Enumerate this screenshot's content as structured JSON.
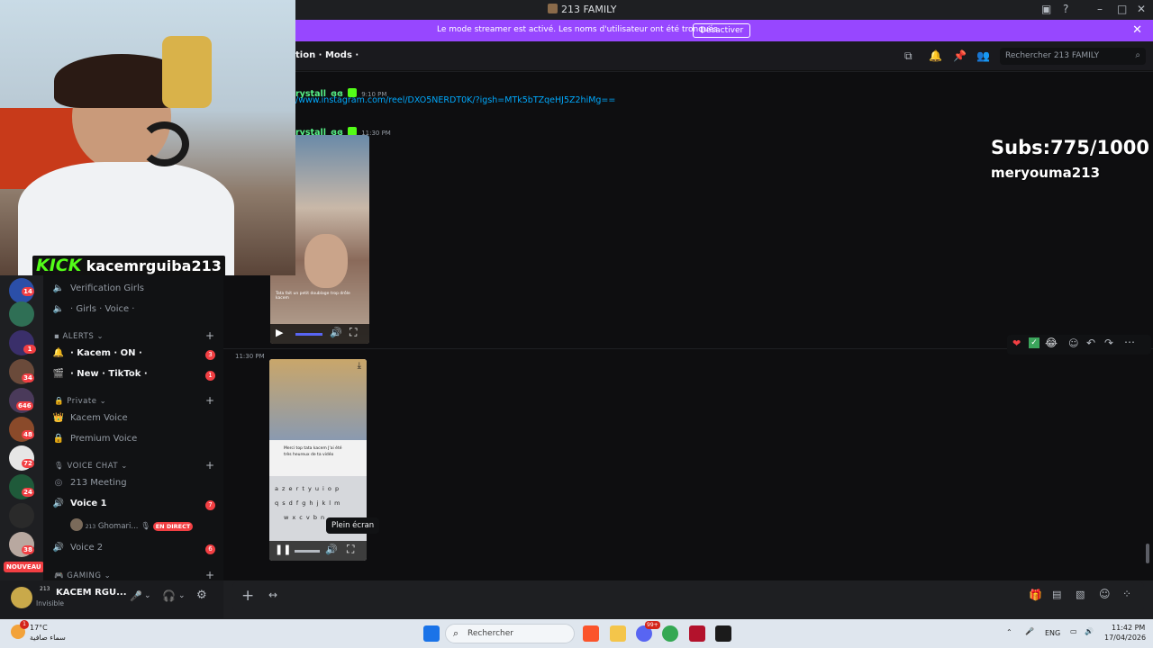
{
  "window": {
    "title": "213 FAMILY"
  },
  "banner": {
    "text": "Le mode streamer est activé. Les noms d'utilisateur ont été tronqués.",
    "button_label": "Désactiver"
  },
  "header": {
    "breadcrumb": "tion · Mods ·",
    "search_placeholder": "Rechercher 213 FAMILY"
  },
  "server_rail": {
    "badges": [
      "14",
      "1",
      "34",
      "646",
      "48",
      "72",
      "24",
      "38"
    ],
    "new_label": "NOUVEAU"
  },
  "channels": {
    "items": [
      {
        "label": "Verification Girls"
      },
      {
        "label": "· Girls · Voice ·"
      },
      {
        "label": "ALERTS"
      },
      {
        "label": "· Kacem · ON ·",
        "badge": "3"
      },
      {
        "label": "· New · TikTok ·",
        "badge": "1"
      },
      {
        "label": "Private"
      },
      {
        "label": "Kacem Voice"
      },
      {
        "label": "Premium Voice"
      },
      {
        "label": "VOICE CHAT"
      },
      {
        "label": "213 Meeting"
      },
      {
        "label": "Voice 1",
        "badge": "7"
      },
      {
        "label": "Voice 2",
        "badge": "6"
      },
      {
        "label": "GAMING"
      }
    ],
    "voice_user": {
      "name": "Ghomari...",
      "live_label": "EN DIRECT",
      "tag": "213"
    }
  },
  "user_panel": {
    "name": "KACEM RGU...",
    "tag": "213",
    "status": "Invisible"
  },
  "messages": [
    {
      "author": "rystall",
      "author_suffix": "ɞɞ",
      "time": "9:10 PM",
      "link": "/www.instagram.com/reel/DXO5NERDT0K/?igsh=MTk5bTZqeHJ5Z2hiMg=="
    },
    {
      "author": "rystall",
      "author_suffix": "ɞɞ",
      "time": "11:30 PM",
      "video_caption": "Tata fait un petit doublage trop drôle kacem"
    },
    {
      "time": "11:30 PM",
      "video_text": "Merci top tata kacem J'ai été très heureux de ta vidéo",
      "keyboard_rows": [
        "a z e r t y u i o p",
        "q s d f g h j k l m",
        "w x c v b n"
      ]
    }
  ],
  "reactions": [
    "heart",
    "check",
    "joy"
  ],
  "tooltip": "Plein écran",
  "overlay": {
    "subs": "Subs:775/1000",
    "sub_user": "meryouma213",
    "kick_label": "KICK",
    "kick_channel": "kacemrguiba213"
  },
  "taskbar": {
    "weather_temp": "17°C",
    "weather_desc": "سماء صافية",
    "weather_badge": "1",
    "search_label": "Rechercher",
    "discord_badge": "99+",
    "lang": "ENG",
    "time": "11:42 PM",
    "date": "17/04/2026"
  },
  "colors": {
    "banner": "#9747ff",
    "accent_green": "#57f287",
    "link": "#00a8fc",
    "badge_red": "#f23f43"
  }
}
